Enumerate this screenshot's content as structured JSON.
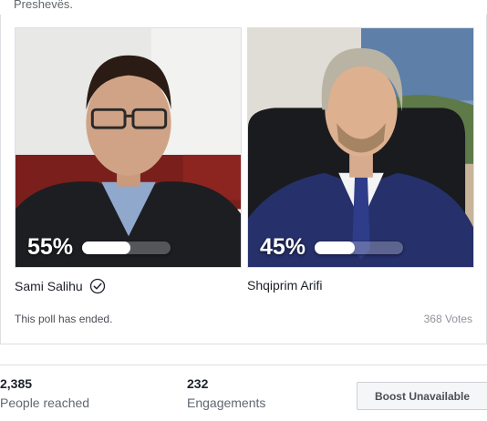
{
  "post": {
    "caption_tail": "Preshevës."
  },
  "poll": {
    "options": [
      {
        "percent_label": "55%",
        "percent": 55,
        "name": "Sami Salihu",
        "verified": true
      },
      {
        "percent_label": "45%",
        "percent": 45,
        "name": "Shqiprim Arifi",
        "verified": false
      }
    ],
    "status": "This poll has ended.",
    "votes": "368 Votes"
  },
  "stats": {
    "reached_count": "2,385",
    "reached_label": "People reached",
    "engagements_count": "232",
    "engagements_label": "Engagements"
  },
  "actions": {
    "boost_label": "Boost Unavailable"
  },
  "icons": {
    "verified": "check-circle-icon"
  }
}
